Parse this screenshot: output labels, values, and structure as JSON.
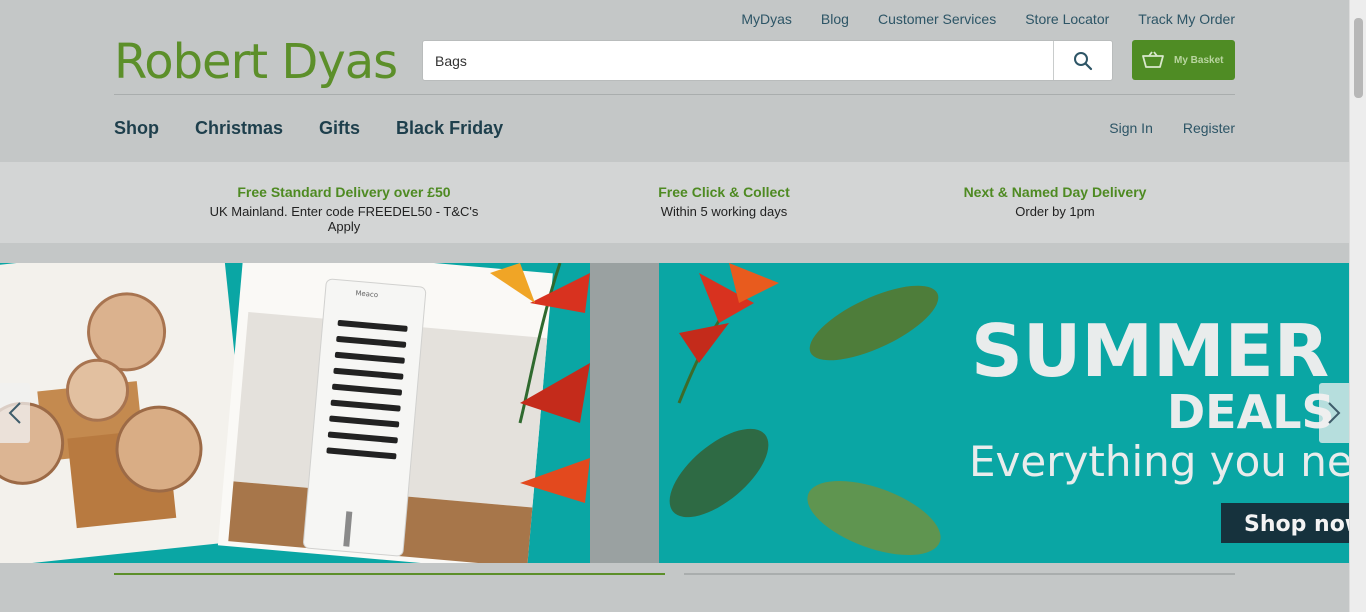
{
  "header": {
    "top_links": [
      "MyDyas",
      "Blog",
      "Customer Services",
      "Store Locator",
      "Track My Order"
    ],
    "logo_text": "Robert Dyas",
    "search": {
      "value": "Bags"
    },
    "basket_label": "My Basket",
    "nav": [
      "Shop",
      "Christmas",
      "Gifts",
      "Black Friday"
    ],
    "account": {
      "sign_in": "Sign In",
      "register": "Register"
    }
  },
  "usps": [
    {
      "title": "Free Standard Delivery over £50",
      "subtitle": "UK Mainland. Enter code FREEDEL50 - T&C's Apply"
    },
    {
      "title": "Free Click & Collect",
      "subtitle": "Within 5 working days"
    },
    {
      "title": "Next & Named Day Delivery",
      "subtitle": "Order by 1pm"
    }
  ],
  "banner": {
    "product_brand": "Meaco",
    "headline": "SUMMER",
    "subheadline": "DEALS",
    "tagline": "Everything you need",
    "cta": "Shop now"
  },
  "colors": {
    "brand_green": "#5c8f2a",
    "teal": "#0aa6a4",
    "navy": "#16323d"
  },
  "icons": [
    "search-icon",
    "basket-icon",
    "chevron-left-icon",
    "chevron-right-icon"
  ]
}
